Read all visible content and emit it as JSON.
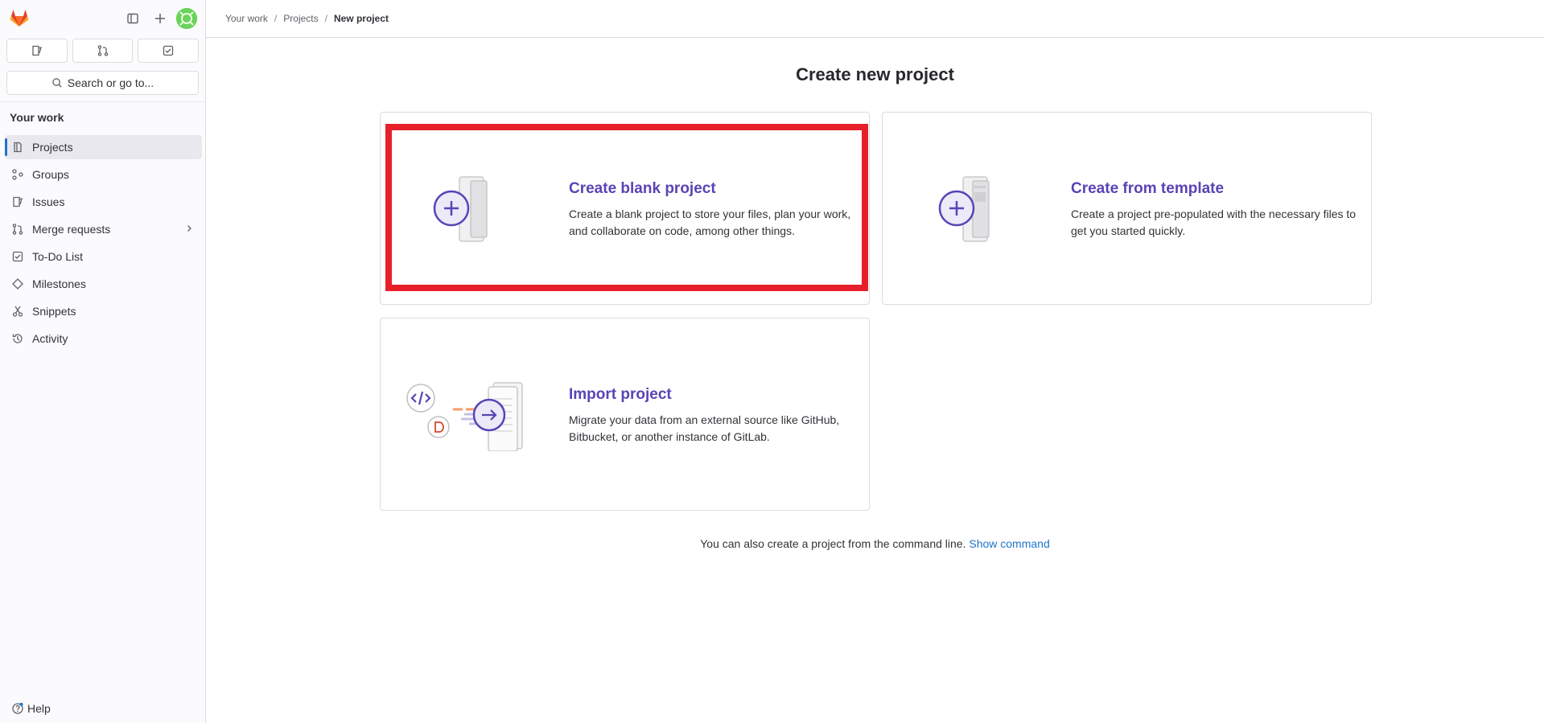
{
  "sidebar": {
    "quick_actions": [
      "issues-icon",
      "merge-request-icon",
      "todo-icon"
    ],
    "search_label": "Search or go to...",
    "section_title": "Your work",
    "items": [
      {
        "label": "Projects",
        "icon": "project-icon"
      },
      {
        "label": "Groups",
        "icon": "group-icon"
      },
      {
        "label": "Issues",
        "icon": "issues-icon"
      },
      {
        "label": "Merge requests",
        "icon": "merge-request-icon"
      },
      {
        "label": "To-Do List",
        "icon": "todo-icon"
      },
      {
        "label": "Milestones",
        "icon": "milestone-icon"
      },
      {
        "label": "Snippets",
        "icon": "snippet-icon"
      },
      {
        "label": "Activity",
        "icon": "history-icon"
      }
    ],
    "help_label": "Help"
  },
  "breadcrumb": {
    "items": [
      "Your work",
      "Projects",
      "New project"
    ]
  },
  "main": {
    "title": "Create new project",
    "cards": [
      {
        "title": "Create blank project",
        "description": "Create a blank project to store your files, plan your work, and collaborate on code, among other things."
      },
      {
        "title": "Create from template",
        "description": "Create a project pre-populated with the necessary files to get you started quickly."
      },
      {
        "title": "Import project",
        "description": "Migrate your data from an external source like GitHub, Bitbucket, or another instance of GitLab."
      }
    ],
    "footer_text": "You can also create a project from the command line.",
    "footer_link": "Show command"
  },
  "colors": {
    "accent": "#5943b6",
    "link": "#1f75cb",
    "highlight": "#e6202a"
  }
}
